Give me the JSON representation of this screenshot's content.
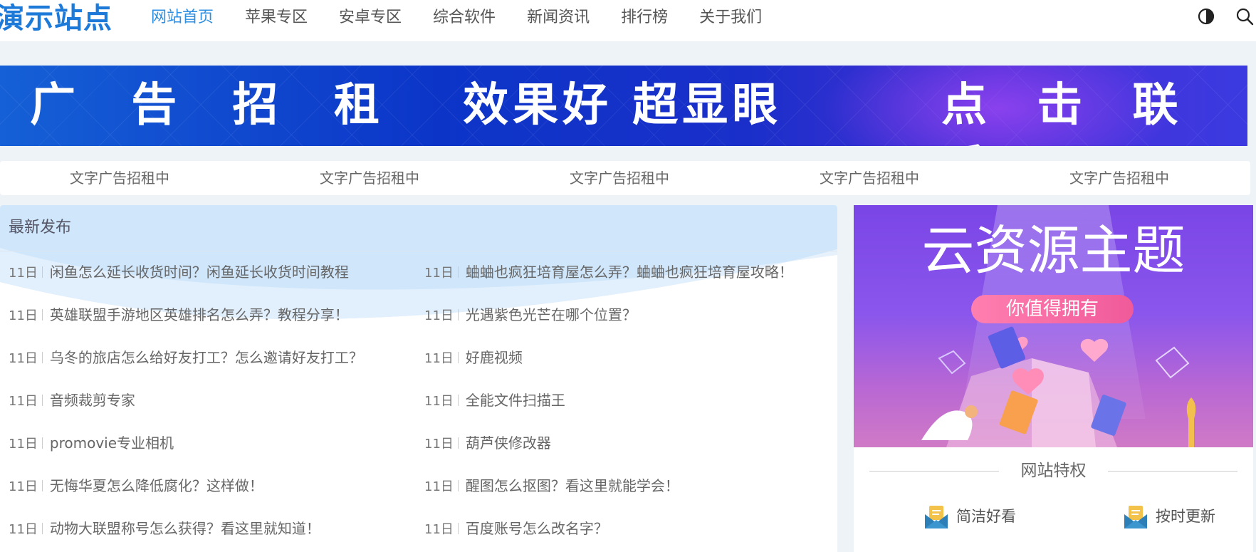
{
  "header": {
    "logo": "演示站点",
    "nav": [
      "网站首页",
      "苹果专区",
      "安卓专区",
      "综合软件",
      "新闻资讯",
      "排行榜",
      "关于我们"
    ],
    "active_nav": "网站首页",
    "icons": [
      "contrast-icon",
      "search-icon"
    ]
  },
  "banner": {
    "left": "广 告 招 租",
    "center": "效果好 超显眼",
    "right": "点 击 联 系"
  },
  "text_ads": [
    "文字广告招租中",
    "文字广告招租中",
    "文字广告招租中",
    "文字广告招租中",
    "文字广告招租中"
  ],
  "latest": {
    "title": "最新发布",
    "left": [
      {
        "date": "11日",
        "title": "闲鱼怎么延长收货时间？闲鱼延长收货时间教程"
      },
      {
        "date": "11日",
        "title": "英雄联盟手游地区英雄排名怎么弄？教程分享！"
      },
      {
        "date": "11日",
        "title": "乌冬的旅店怎么给好友打工？怎么邀请好友打工？"
      },
      {
        "date": "11日",
        "title": "音频裁剪专家"
      },
      {
        "date": "11日",
        "title": "promovie专业相机"
      },
      {
        "date": "11日",
        "title": "无悔华夏怎么降低腐化？这样做！"
      },
      {
        "date": "11日",
        "title": "动物大联盟称号怎么获得？看这里就知道！"
      }
    ],
    "right": [
      {
        "date": "11日",
        "title": "蛐蛐也疯狂培育屋怎么弄？蛐蛐也疯狂培育屋攻略！"
      },
      {
        "date": "11日",
        "title": "光遇紫色光芒在哪个位置？"
      },
      {
        "date": "11日",
        "title": "好鹿视频"
      },
      {
        "date": "11日",
        "title": "全能文件扫描王"
      },
      {
        "date": "11日",
        "title": "葫芦侠修改器"
      },
      {
        "date": "11日",
        "title": "醒图怎么抠图？看这里就能学会！"
      },
      {
        "date": "11日",
        "title": "百度账号怎么改名字？"
      }
    ]
  },
  "promo": {
    "title": "云资源主题",
    "pill": "你值得拥有"
  },
  "perks": {
    "title": "网站特权",
    "items": [
      "简洁好看",
      "按时更新"
    ]
  }
}
